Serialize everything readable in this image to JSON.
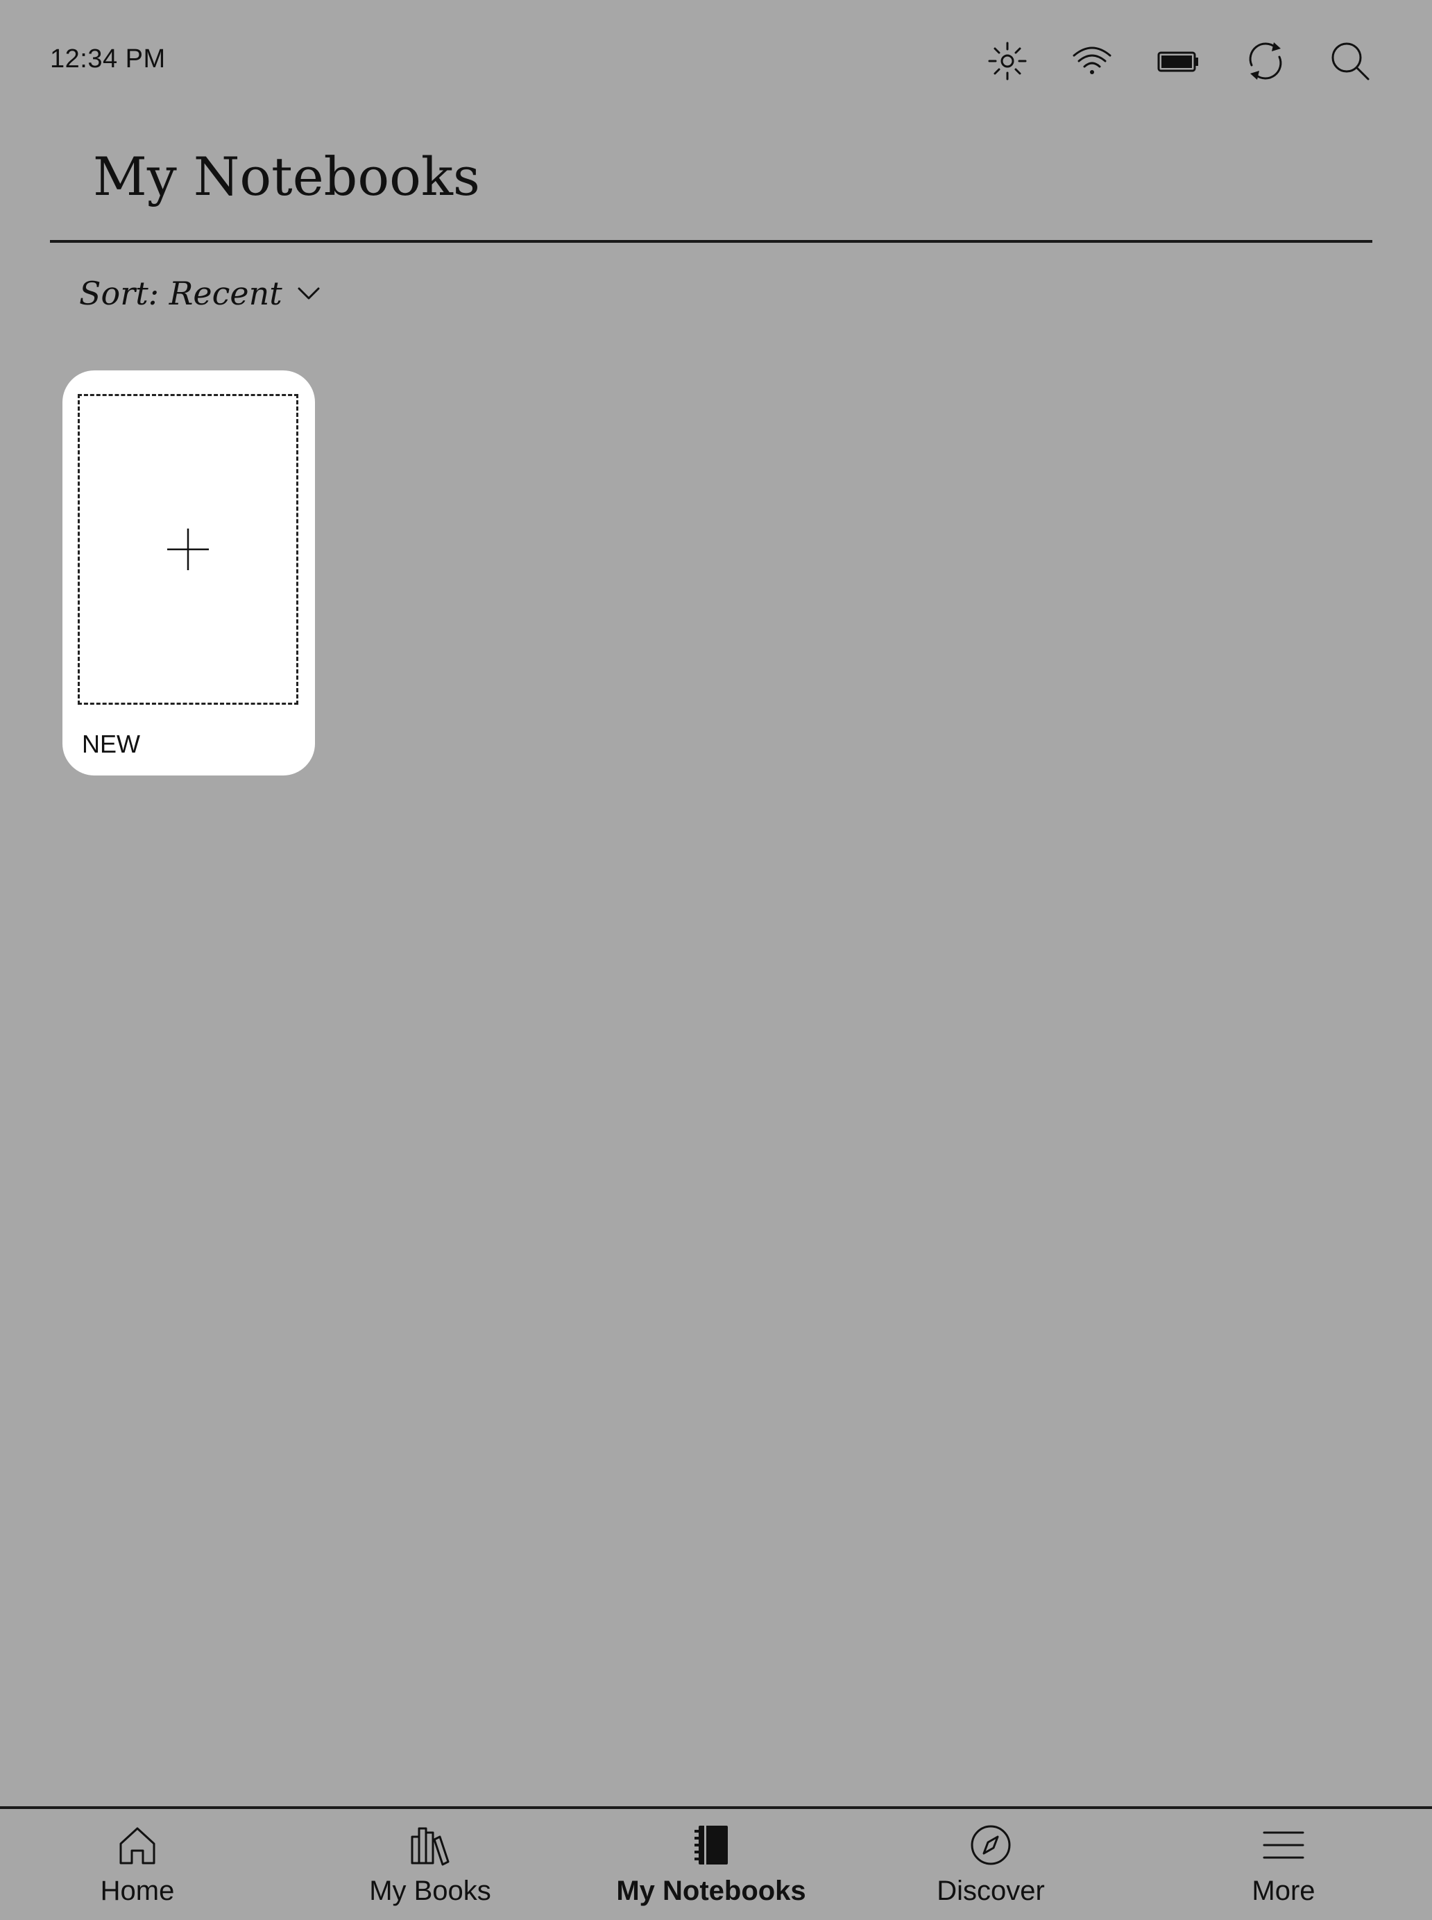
{
  "status_bar": {
    "time": "12:34 PM",
    "icons": [
      "brightness-icon",
      "wifi-icon",
      "battery-icon",
      "sync-icon",
      "search-icon"
    ]
  },
  "header": {
    "title": "My Notebooks"
  },
  "sort": {
    "label": "Sort: Recent",
    "icon": "chevron-down-icon"
  },
  "notebooks": {
    "new_card": {
      "label": "NEW",
      "icon": "plus-icon"
    }
  },
  "bottom_nav": {
    "items": [
      {
        "label": "Home",
        "icon": "home-icon",
        "active": false
      },
      {
        "label": "My Books",
        "icon": "books-icon",
        "active": false
      },
      {
        "label": "My Notebooks",
        "icon": "notebook-icon",
        "active": true
      },
      {
        "label": "Discover",
        "icon": "compass-icon",
        "active": false
      },
      {
        "label": "More",
        "icon": "menu-icon",
        "active": false
      }
    ]
  },
  "colors": {
    "background": "#a7a7a7",
    "card": "#ffffff",
    "text": "#111111"
  }
}
